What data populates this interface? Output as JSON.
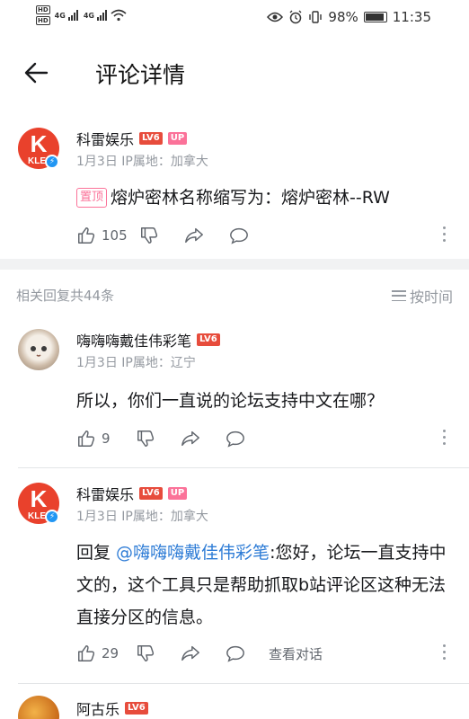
{
  "status_bar": {
    "hd1": "HD",
    "hd2": "HD",
    "sim1": "4G",
    "sim2": "4G",
    "battery": "98%",
    "time": "11:35"
  },
  "nav": {
    "title": "评论详情"
  },
  "main_comment": {
    "avatar_text": "K",
    "avatar_sub": "KLE",
    "username": "科雷娱乐",
    "level": "LV6",
    "up": "UP",
    "meta": "1月3日 IP属地：加拿大",
    "pin": "置顶",
    "text": "熔炉密林名称缩写为：熔炉密林--RW",
    "likes": "105"
  },
  "reply_header": {
    "count": "相关回复共44条",
    "sort": "按时间"
  },
  "replies": [
    {
      "username": "嗨嗨嗨戴佳伟彩笔",
      "level": "LV6",
      "meta": "1月3日 IP属地：辽宁",
      "text": "所以，你们一直说的论坛支持中文在哪？",
      "likes": "9"
    },
    {
      "avatar_text": "K",
      "avatar_sub": "KLE",
      "username": "科雷娱乐",
      "level": "LV6",
      "up": "UP",
      "meta": "1月3日 IP属地：加拿大",
      "reply_prefix": "回复 ",
      "mention": "@嗨嗨嗨戴佳伟彩笔",
      "text": ":您好，论坛一直支持中文的，这个工具只是帮助抓取b站评论区这种无法直接分区的信息。",
      "likes": "29",
      "view_convo": "查看对话"
    },
    {
      "username": "阿古乐",
      "level": "LV6"
    }
  ],
  "icons": [
    "back-arrow-icon",
    "thumb-up-icon",
    "thumb-down-icon",
    "share-icon",
    "comment-bubble-icon",
    "more-vertical-icon",
    "sort-lines-icon",
    "wifi-icon",
    "signal-icon",
    "eye-icon",
    "alarm-icon",
    "vibrate-icon",
    "battery-icon"
  ],
  "colors": {
    "accent_pink": "#fb7299",
    "level_red": "#e74c3c",
    "mention_blue": "#2e7cd6",
    "secondary_gray": "#9499a0"
  }
}
